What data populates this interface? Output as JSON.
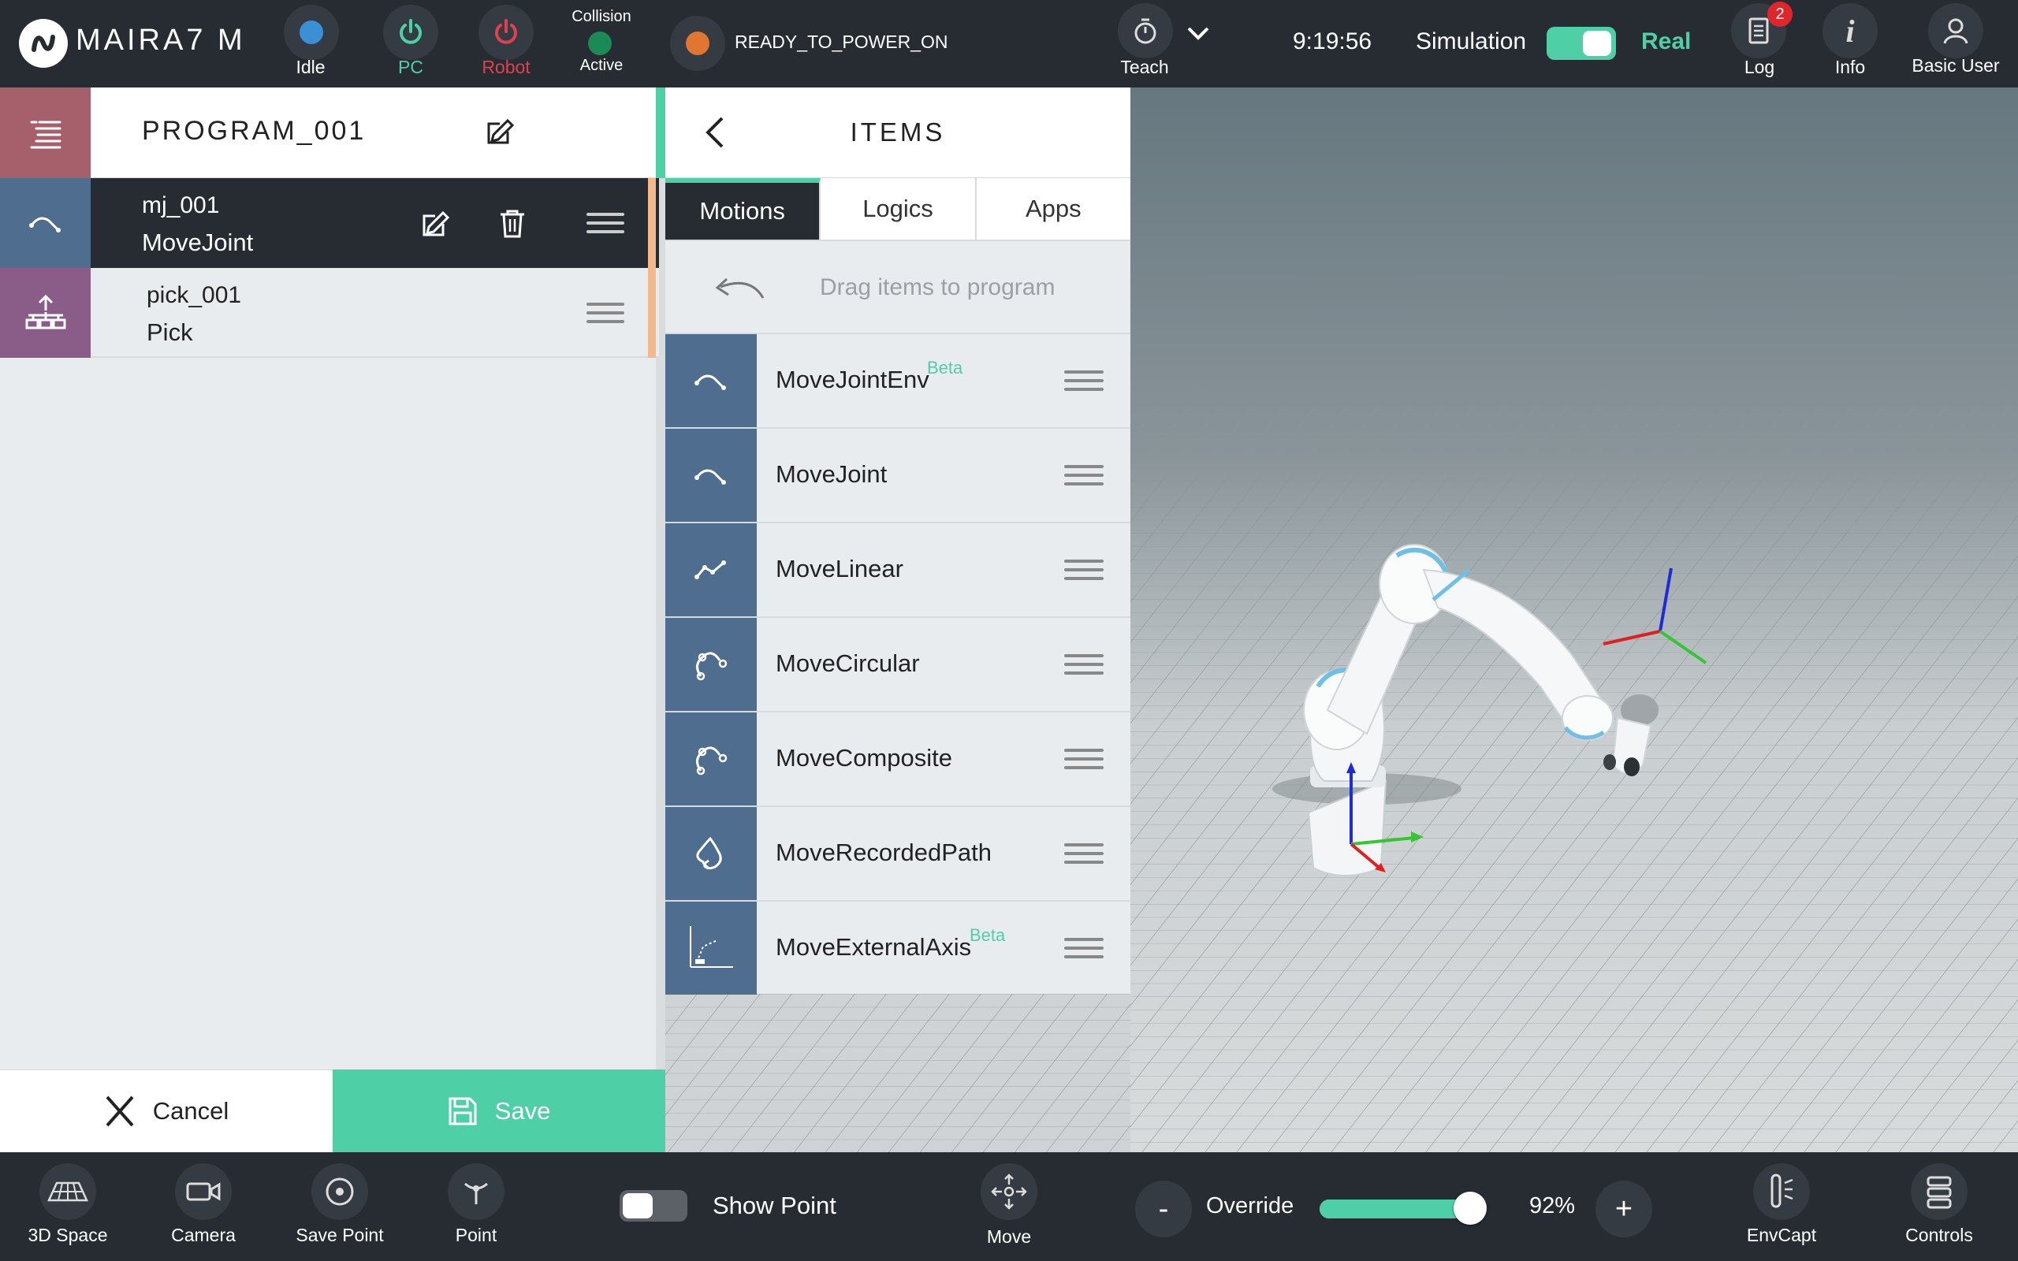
{
  "brand": {
    "name": "MAIRA7 M"
  },
  "topbar": {
    "idle_label": "Idle",
    "pc_label": "PC",
    "robot_label": "Robot",
    "collision_label": "Collision",
    "collision_state": "Active",
    "status_text": "READY_TO_POWER_ON",
    "teach_label": "Teach",
    "time": "9:19:56",
    "simulation_label": "Simulation",
    "mode_label": "Real",
    "log_label": "Log",
    "log_badge": "2",
    "info_label": "Info",
    "user_label": "Basic User",
    "colors": {
      "idle": "#3b8fd4",
      "pc": "#4fcfa6",
      "robot": "#e0414e",
      "collision": "#1a8a56",
      "status": "#e0762f"
    }
  },
  "program": {
    "title": "PROGRAM_001",
    "rows": [
      {
        "name": "mj_001",
        "type": "MoveJoint",
        "icon": "movejoint-icon"
      },
      {
        "name": "pick_001",
        "type": "Pick",
        "icon": "pick-icon"
      }
    ],
    "cancel_label": "Cancel",
    "save_label": "Save"
  },
  "items": {
    "title": "ITEMS",
    "tabs": [
      {
        "label": "Motions",
        "active": true
      },
      {
        "label": "Logics",
        "active": false
      },
      {
        "label": "Apps",
        "active": false
      }
    ],
    "drag_hint": "Drag items to program",
    "beta_label": "Beta",
    "list": [
      {
        "label": "MoveJointEnv",
        "beta": true,
        "icon": "movejoint-icon"
      },
      {
        "label": "MoveJoint",
        "beta": false,
        "icon": "movejoint-icon"
      },
      {
        "label": "MoveLinear",
        "beta": false,
        "icon": "movelinear-icon"
      },
      {
        "label": "MoveCircular",
        "beta": false,
        "icon": "movecircular-icon"
      },
      {
        "label": "MoveComposite",
        "beta": false,
        "icon": "movecomposite-icon"
      },
      {
        "label": "MoveRecordedPath",
        "beta": false,
        "icon": "moverecordedpath-icon"
      },
      {
        "label": "MoveExternalAxis",
        "beta": true,
        "icon": "moveexternalaxis-icon"
      }
    ]
  },
  "bottombar": {
    "space_label": "3D Space",
    "camera_label": "Camera",
    "save_point_label": "Save Point",
    "point_label": "Point",
    "show_point_label": "Show Point",
    "move_label": "Move",
    "override_label": "Override",
    "override_minus": "-",
    "override_plus": "+",
    "override_value": "92%",
    "override_fraction": 0.92,
    "envcapt_label": "EnvCapt",
    "controls_label": "Controls"
  }
}
